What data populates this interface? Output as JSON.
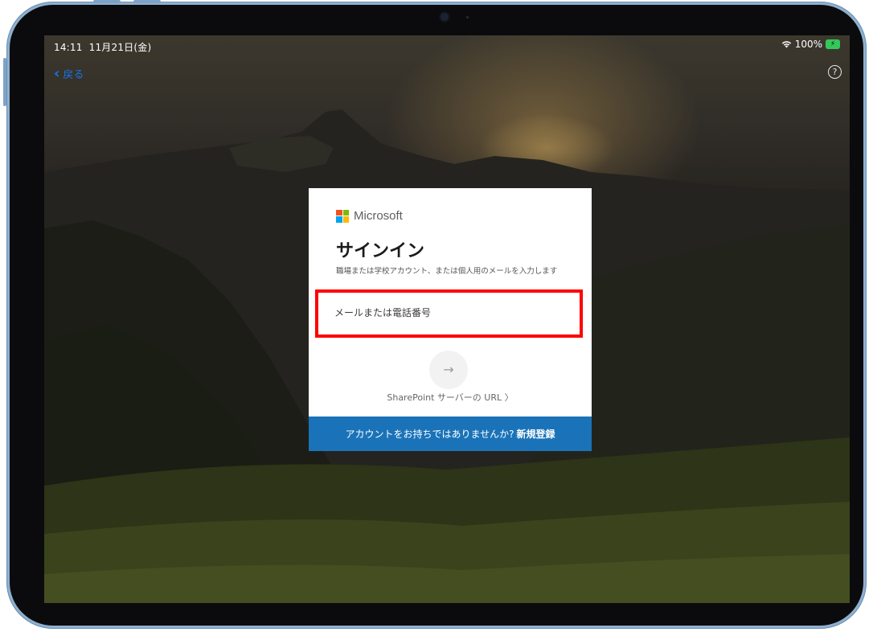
{
  "status_bar": {
    "time": "14:11",
    "date": "11月21日(金)",
    "wifi_icon": "wifi-icon",
    "battery": "100%",
    "battery_icon": "battery-charging-icon"
  },
  "nav": {
    "back_label": "戻る",
    "back_icon": "chevron-left-icon",
    "help_label": "?",
    "help_icon": "question-circle-icon"
  },
  "signin": {
    "brand": "Microsoft",
    "brand_colors": [
      "#f25022",
      "#7fba00",
      "#00a4ef",
      "#ffb900"
    ],
    "title": "サインイン",
    "description": "職場または学校アカウント、または個人用のメールを入力します",
    "email_placeholder": "メールまたは電話番号",
    "email_value": "",
    "next_label": "→",
    "sharepoint_link": "SharePoint サーバーの URL 〉",
    "signup_prompt": "アカウントをお持ちではありませんか?",
    "signup_link": "新規登録"
  },
  "colors": {
    "accent_blue": "#1a73b8",
    "highlight_red": "#ff0000",
    "back_link_blue": "#1a73e8",
    "battery_green": "#34c759"
  }
}
